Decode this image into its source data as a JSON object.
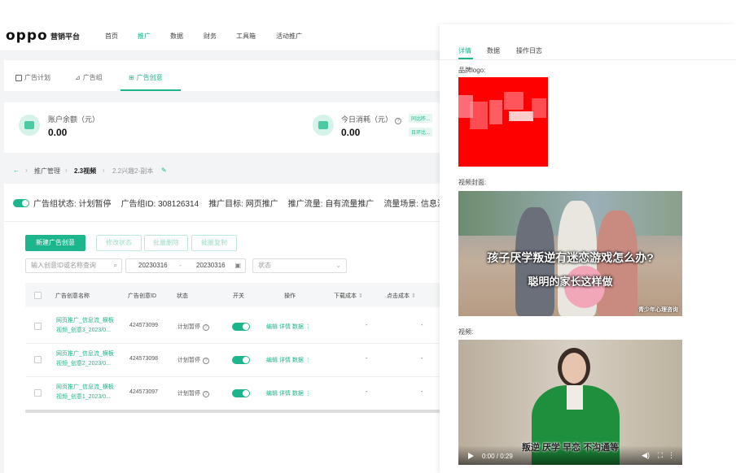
{
  "header": {
    "logo": "oppo",
    "platform": "营销平台",
    "nav": [
      "首页",
      "推广",
      "数据",
      "财务",
      "工具箱",
      "活动推广"
    ],
    "active_nav": "推广"
  },
  "content_tabs": [
    "广告计划",
    "广告组",
    "广告创意"
  ],
  "active_content_tab": "广告创意",
  "balance": {
    "account_label": "账户余额（元）",
    "account_value": "0.00",
    "today_label": "今日消耗（元）",
    "today_value": "0.00",
    "badge1": "同比昨...",
    "badge2": "日环比..."
  },
  "breadcrumb": {
    "items": [
      "推广管理",
      "2.3视频",
      "2.2兴趣2-副本"
    ]
  },
  "group_status": {
    "text": "广告组状态: 计划暂停",
    "id": "广告组ID: 308126314",
    "target": "推广目标: 网页推广",
    "traffic": "推广流量: 自有流量推广",
    "scene": "流量场景: 信息流"
  },
  "toolbar": {
    "new_button": "新建广告创意",
    "edit_status": "修改状态",
    "batch_delete": "批量删除",
    "batch_copy": "批量复制",
    "search_placeholder": "输入创意ID或名称查询",
    "date_from": "20230316",
    "date_sep": "-",
    "date_to": "20230316",
    "status_placeholder": "状态"
  },
  "table": {
    "columns": [
      "广告创意名称",
      "广告创意ID",
      "状态",
      "开关",
      "操作",
      "下载成本",
      "点击成本"
    ],
    "rows": [
      {
        "name_line1": "网页推广_信息流_横板",
        "name_line2": "视频_创意3_2023/0...",
        "id": "424573099",
        "status": "计划暂停",
        "actions": "编辑 详情 数据",
        "c1": "-",
        "c2": "-"
      },
      {
        "name_line1": "网页推广_信息流_横板",
        "name_line2": "视频_创意2_2023/0...",
        "id": "424573098",
        "status": "计划暂停",
        "actions": "编辑 详情 数据",
        "c1": "-",
        "c2": "-"
      },
      {
        "name_line1": "网页推广_信息流_横板",
        "name_line2": "视频_创意1_2023/0...",
        "id": "424573097",
        "status": "计划暂停",
        "actions": "编辑 详情 数据",
        "c1": "-",
        "c2": "-"
      }
    ]
  },
  "panel": {
    "tabs": [
      "详情",
      "数据",
      "操作日志"
    ],
    "active_tab": "详情",
    "brand_logo_label": "品牌logo:",
    "cover_label": "视频封面:",
    "cover_caption1": "孩子厌学叛逆有迷恋游戏怎么办?",
    "cover_caption2": "聪明的家长这样做",
    "cover_watermark": "青少年心理咨询",
    "video_label": "视频:",
    "video_time": "0:00 / 0:29",
    "video_subtitle": "叛逆 厌学 早恋 不沟通等"
  },
  "colors": {
    "accent": "#1cb58c",
    "logo_red": "#ff0000"
  }
}
